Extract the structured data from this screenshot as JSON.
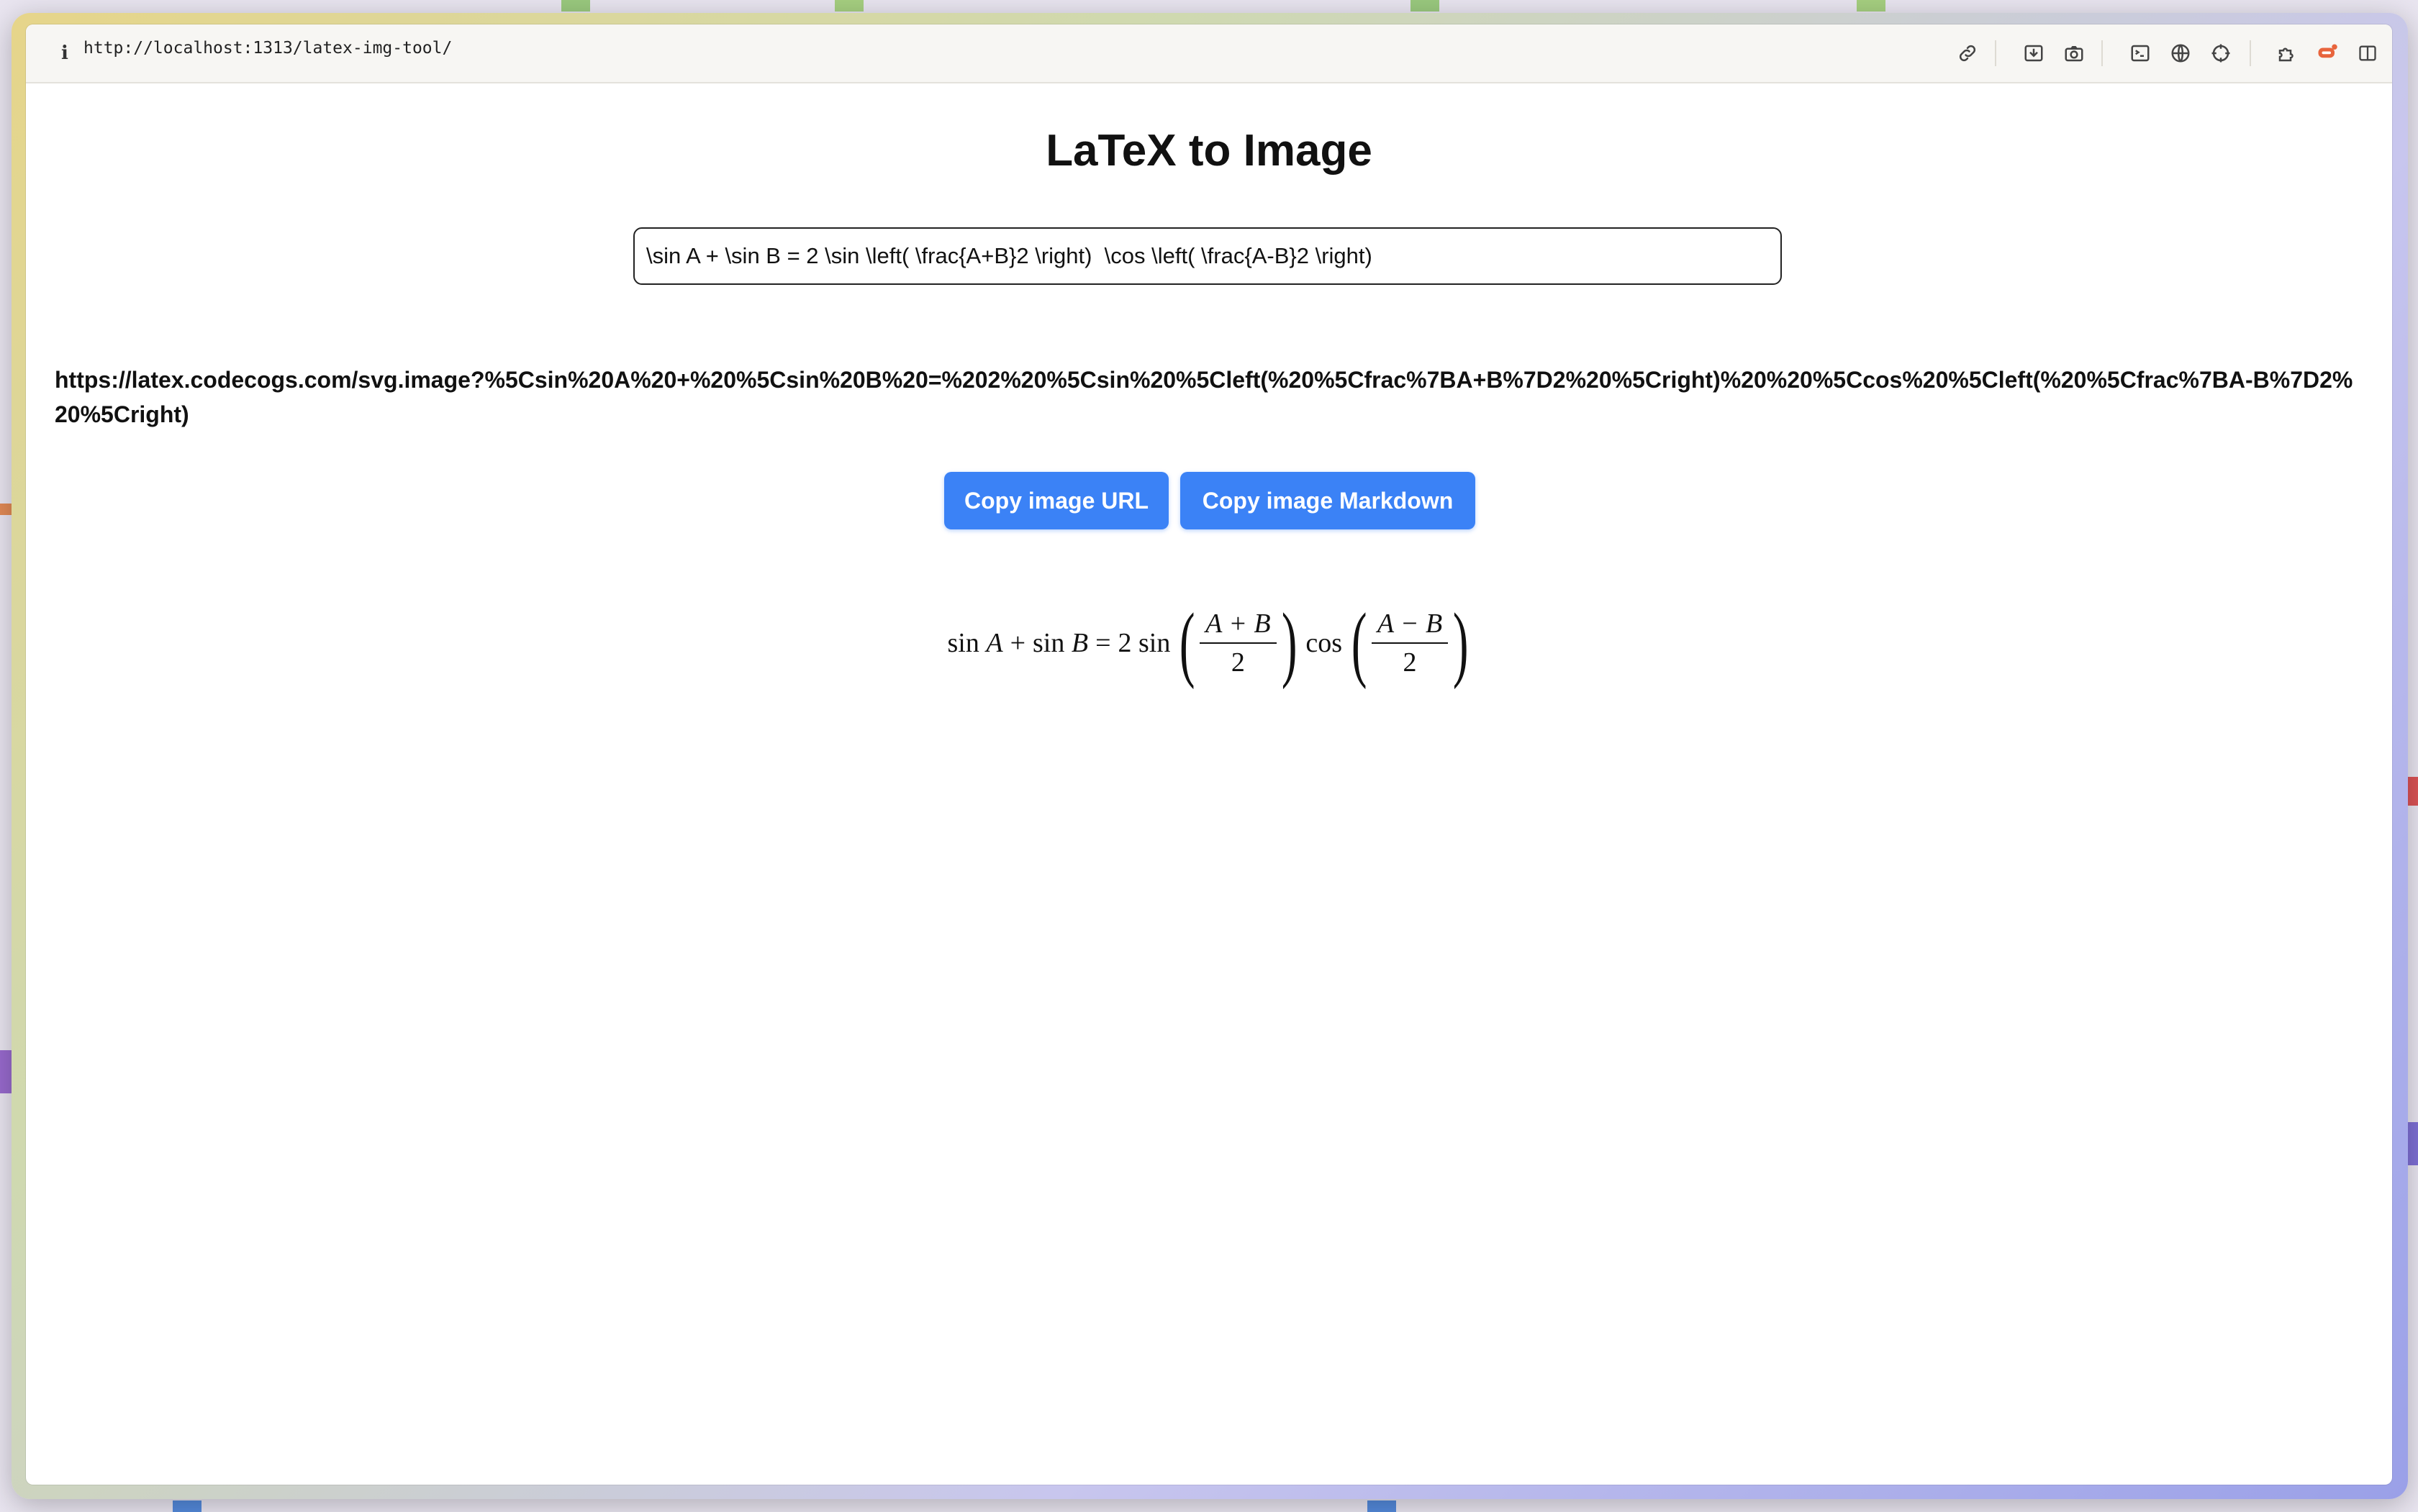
{
  "browser": {
    "url": "http://localhost:1313/latex-img-tool/",
    "info_label": "i",
    "toolbar_icons": [
      "link-icon",
      "download-icon",
      "camera-icon",
      "terminal-icon",
      "globe-icon",
      "crosshair-icon",
      "extensions-icon",
      "chat-icon",
      "sidebar-icon"
    ]
  },
  "page": {
    "title": "LaTeX to Image",
    "latex_input_value": "\\sin A + \\sin B = 2 \\sin \\left( \\frac{A+B}2 \\right)  \\cos \\left( \\frac{A-B}2 \\right)",
    "image_url": "https://latex.codecogs.com/svg.image?%5Csin%20A%20+%20%5Csin%20B%20=%202%20%5Csin%20%5Cleft(%20%5Cfrac%7BA+B%7D2%20%5Cright)%20%20%5Ccos%20%5Cleft(%20%5Cfrac%7BA-B%7D2%20%5Cright)",
    "copy_url_button": "Copy image URL",
    "copy_markdown_button": "Copy image Markdown"
  },
  "formula": {
    "sin1": "sin",
    "A": "A",
    "plus": "+",
    "sin2": "sin",
    "B": "B",
    "equals": "=",
    "two": "2",
    "sin3": "sin",
    "frac1_num": "A + B",
    "frac1_den": "2",
    "cos": "cos",
    "frac2_num": "A − B",
    "frac2_den": "2"
  },
  "colors": {
    "accent": "#3b82f6",
    "button_text": "#ffffff",
    "page_bg": "#ffffff"
  }
}
